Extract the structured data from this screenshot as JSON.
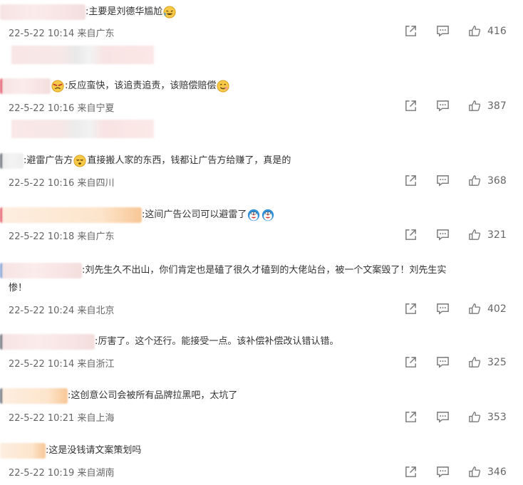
{
  "comments": [
    {
      "text": ":主要是刘德华尴尬",
      "date": "22-5-22 10:14",
      "location": "来自广东",
      "likes": "416",
      "emoji": [
        "laughing-crying-emoji"
      ]
    },
    {
      "text": ":反应蛮快，该追责追责，该赔偿赔偿",
      "date": "22-5-22 10:16",
      "location": "来自宁夏",
      "likes": "387",
      "emoji": [
        "angry-emoji",
        "smile-emoji"
      ]
    },
    {
      "text1": ":避雷广告方",
      "text2": "直接搬人家的东西，钱都让广告方给赚了，真是的",
      "date": "22-5-22 10:16",
      "location": "来自四川",
      "likes": "368",
      "emoji": [
        "sleepy-emoji"
      ]
    },
    {
      "text": ":这间广告公司可以避雷了",
      "date": "22-5-22 10:18",
      "location": "来自广东",
      "likes": "321",
      "emoji": [
        "doraemon-emoji",
        "doraemon-emoji"
      ]
    },
    {
      "line1": ":刘先生久不出山，你们肯定也是磕了很久才磕到的大佬站台，被一个文案毁了！刘先生实",
      "line2": "惨！",
      "date": "22-5-22 10:24",
      "location": "来自北京",
      "likes": "402"
    },
    {
      "text": ":厉害了。这个还行。能接受一点。该补偿补偿改认错认错。",
      "date": "22-5-22 10:14",
      "location": "来自浙江",
      "likes": "325"
    },
    {
      "text": ":这创意公司会被所有品牌拉黑吧，太坑了",
      "date": "22-5-22 10:21",
      "location": "来自上海",
      "likes": "353"
    },
    {
      "text": ":这是没钱请文案策划吗",
      "date": "22-5-22 10:19",
      "location": "来自湖南",
      "likes": "346"
    }
  ],
  "icons": {
    "share": "share-icon",
    "comment": "comment-icon",
    "like": "thumbs-up-icon"
  }
}
